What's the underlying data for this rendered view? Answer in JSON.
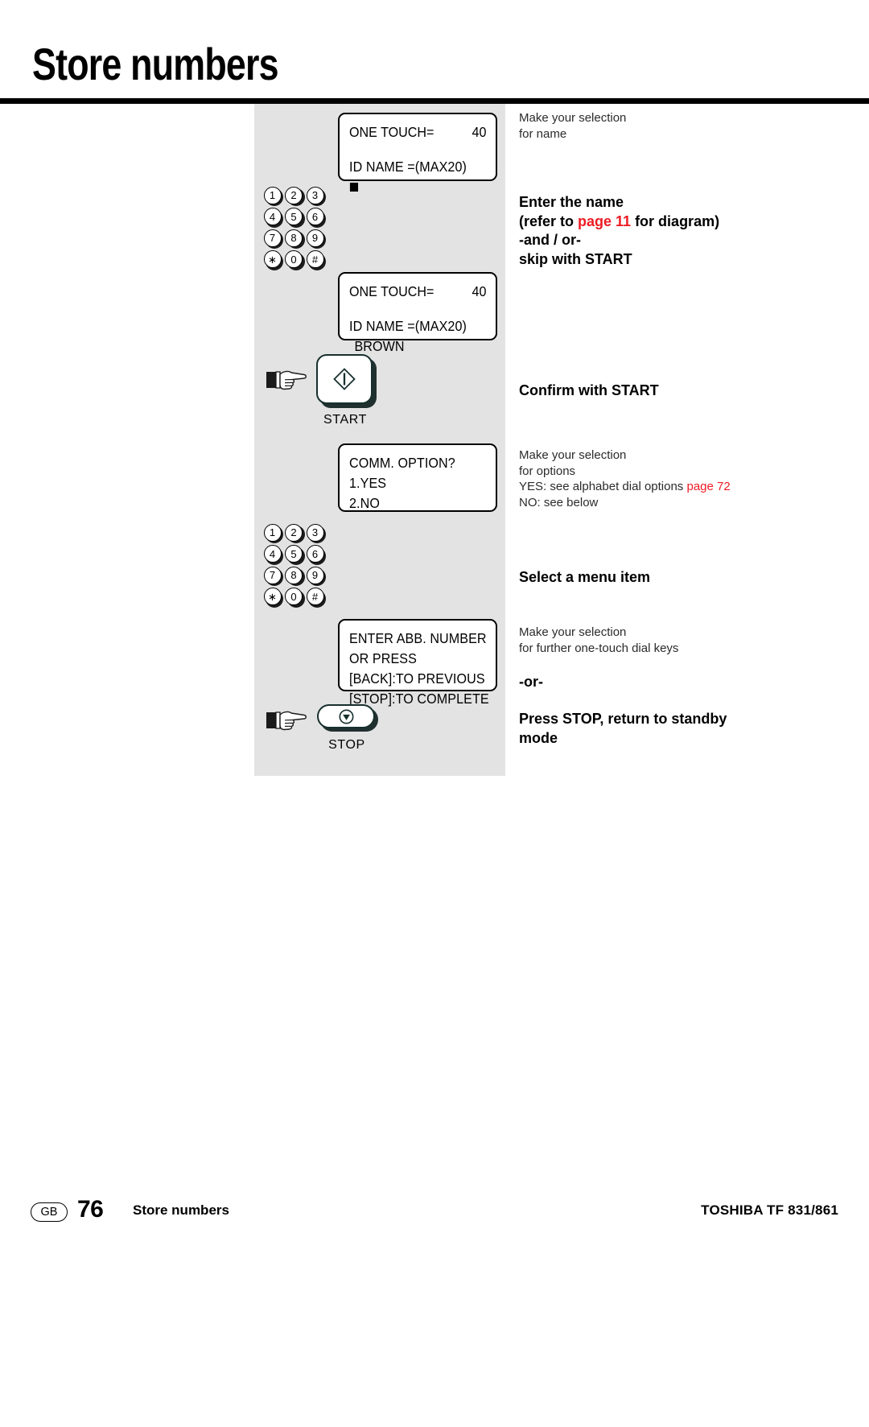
{
  "header": {
    "title": "Store numbers"
  },
  "displays": {
    "lcd1": {
      "label": "ONE TOUCH=",
      "value": "40",
      "line2": "ID NAME =(MAX20)",
      "cursor": true
    },
    "lcd2": {
      "label": "ONE TOUCH=",
      "value": "40",
      "line2": "ID NAME =(MAX20)",
      "line3": "BROWN"
    },
    "lcd3": {
      "line1": "COMM. OPTION?",
      "line2": "1.YES",
      "line3": "2.NO"
    },
    "lcd4": {
      "line1": "ENTER ABB. NUMBER",
      "line2": "OR PRESS",
      "line3": "[BACK]:TO PREVIOUS",
      "line4": "[STOP]:TO COMPLETE"
    }
  },
  "keypad": {
    "rows": [
      [
        "1",
        "2",
        "3"
      ],
      [
        "4",
        "5",
        "6"
      ],
      [
        "7",
        "8",
        "9"
      ],
      [
        "∗",
        "0",
        "#"
      ]
    ]
  },
  "buttons": {
    "start": {
      "caption": "START",
      "icon": "diamond-start-icon"
    },
    "stop": {
      "caption": "STOP",
      "icon": "stop-circle-icon"
    }
  },
  "notes": {
    "note1": "Make your selection\nfor  name",
    "instruction1_line1": "Enter the name",
    "instruction1_line2_pre": "(refer to ",
    "instruction1_link": "page 11",
    "instruction1_line2_post": " for diagram)",
    "instruction1_line3": "-and / or-",
    "instruction1_line4": "skip with START",
    "instruction2": "Confirm with START",
    "note2_line1": "Make your selection",
    "note2_line2": "for options",
    "note2_line3_pre": "YES: see alphabet dial options ",
    "note2_link": "page 72",
    "note2_line4": "NO: see below",
    "instruction3": "Select a menu item",
    "note3": "Make your selection\nfor further one-touch dial keys",
    "instruction_or": "-or-",
    "instruction4": "Press STOP, return to standby\nmode"
  },
  "footer": {
    "region": "GB",
    "page": "76",
    "section": "Store numbers",
    "model": "TOSHIBA  TF 831/861"
  },
  "colors": {
    "link_red": "#ee1b24",
    "panel_gray": "#e3e3e3",
    "button_shadow": "#1f302f"
  }
}
